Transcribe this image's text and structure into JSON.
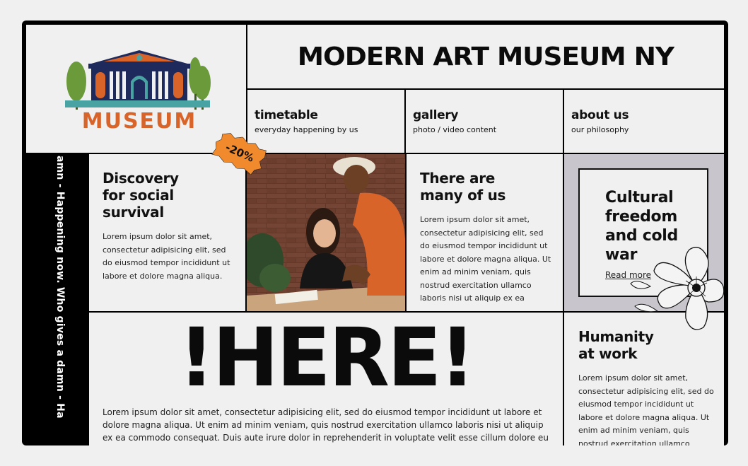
{
  "header": {
    "title": "MODERN ART MUSEUM NY",
    "logo_text": "MUSEUM"
  },
  "nav": [
    {
      "label": "timetable",
      "sub": "everyday happening by us"
    },
    {
      "label": "gallery",
      "sub": "photo / video content"
    },
    {
      "label": "about us",
      "sub": "our philosophy"
    }
  ],
  "ticker": {
    "text": "amn - Happening now. Who gives a damn - Ha"
  },
  "badge": {
    "label": "-20%"
  },
  "cards": {
    "discovery": {
      "title_lines": [
        "Discovery",
        "for social",
        "survival"
      ],
      "body": "Lorem ipsum dolor sit amet, consectetur adipisicing elit, sed do eiusmod tempor incididunt ut labore et dolore magna aliqua."
    },
    "many": {
      "title_lines": [
        "There are",
        "many of us"
      ],
      "body": "Lorem ipsum dolor sit amet, consectetur adipisicing elit, sed do eiusmod tempor incididunt ut labore et dolore magna aliqua. Ut enim ad minim veniam, quis nostrud exercitation ullamco laboris nisi ut aliquip ex ea"
    },
    "cultural": {
      "title_lines": [
        "Cultural",
        "freedom",
        "and cold",
        "war"
      ],
      "link": "Read more"
    },
    "here": {
      "headline": "!HERE!",
      "body": "Lorem ipsum dolor sit amet, consectetur adipisicing elit, sed do eiusmod tempor incididunt ut labore et dolore magna aliqua. Ut enim ad minim veniam, quis nostrud exercitation ullamco laboris nisi ut aliquip ex ea commodo consequat. Duis aute irure dolor in reprehenderit in voluptate velit esse cillum dolore eu fugiat nulla pariatur."
    },
    "humanity": {
      "title_lines": [
        "Humanity",
        "at work"
      ],
      "body": "Lorem ipsum dolor sit amet, consectetur adipisicing elit, sed do eiusmod tempor incididunt ut labore et dolore magna aliqua. Ut enim ad minim veniam, quis nostrud exercitation ullamco"
    }
  },
  "colors": {
    "frame": "#000000",
    "panel": "#f0f0f0",
    "accent_orange": "#f08a2c",
    "logo_navy": "#1f2a5c",
    "logo_orange": "#d9642a",
    "logo_green": "#6b9a3a",
    "logo_teal": "#4aa3a3",
    "lilac_panel": "#c8c6cc"
  },
  "icons": {
    "logo": "museum-building-logo",
    "decoration": "flower-line-art",
    "badge_shape": "jagged-star-burst"
  }
}
